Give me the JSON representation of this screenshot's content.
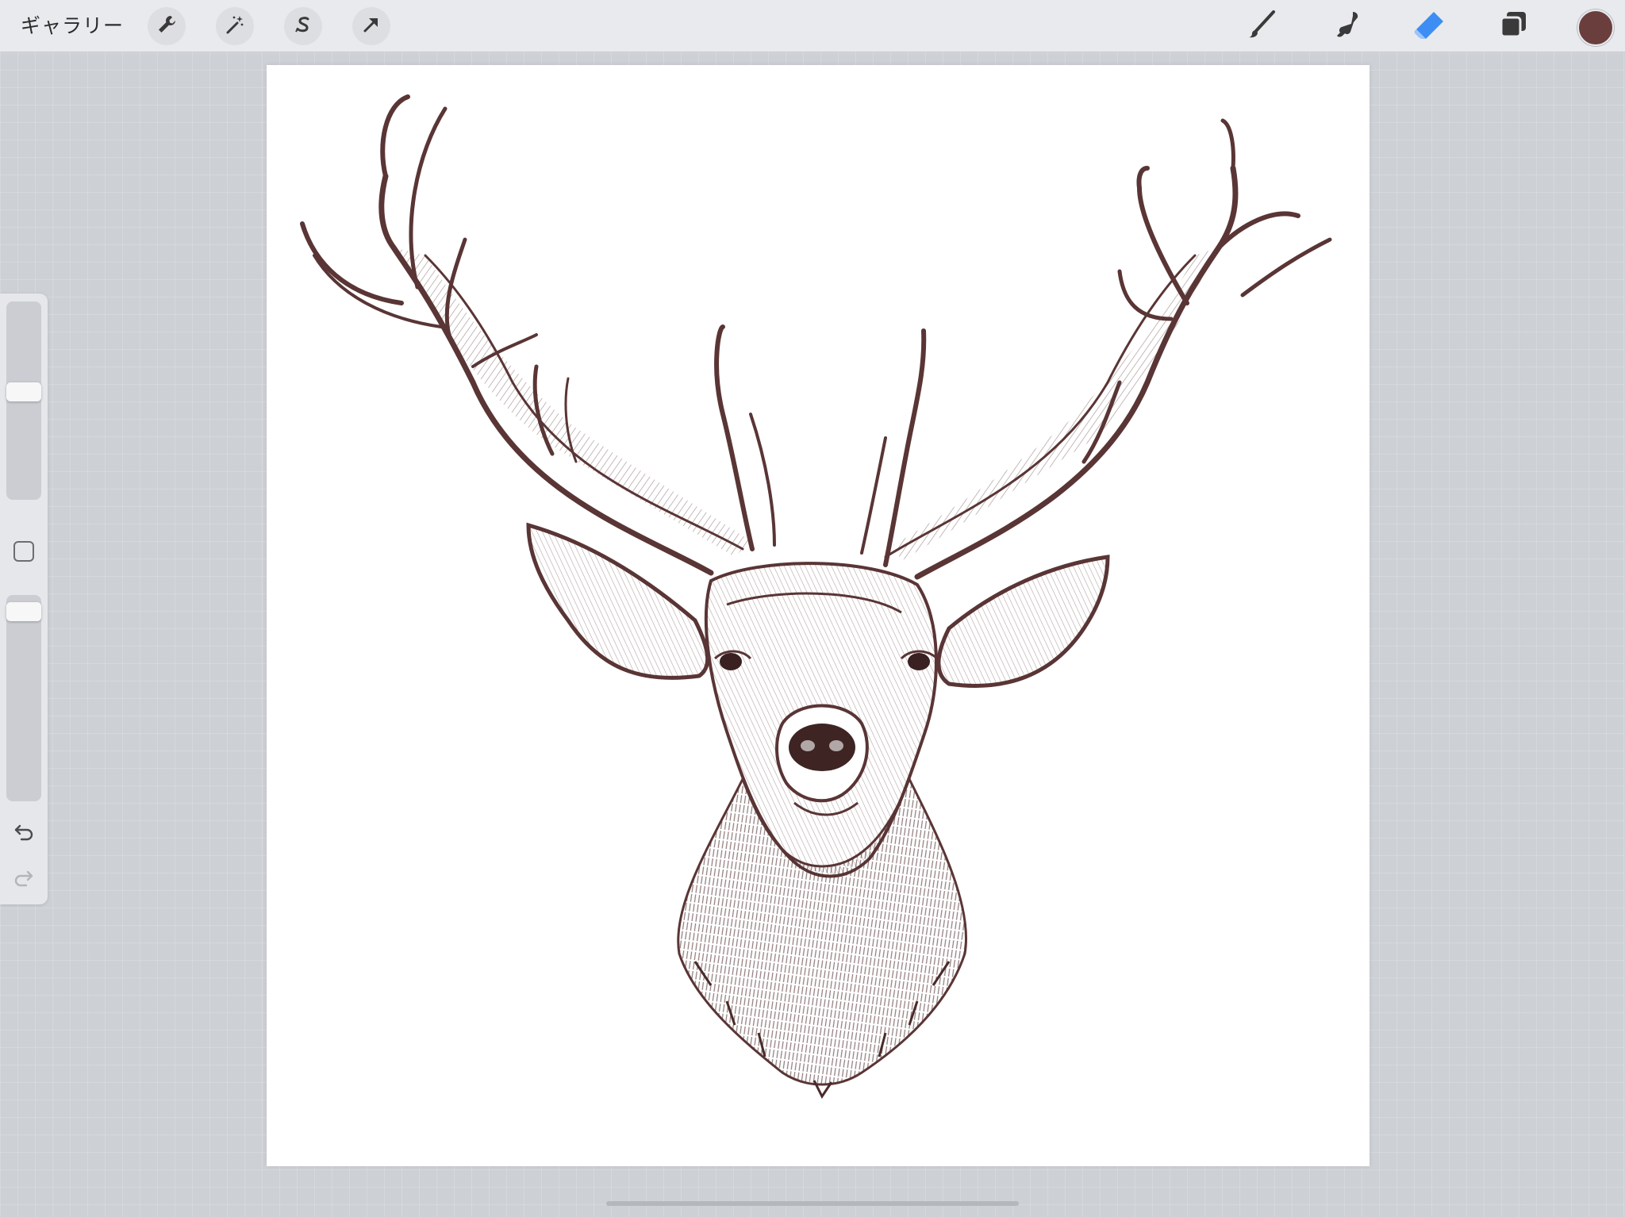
{
  "toolbar": {
    "gallery_label": "ギャラリー",
    "left_tools": [
      "wrench-icon",
      "magic-wand-icon",
      "selection-s-icon",
      "move-arrow-icon"
    ],
    "right_tools": [
      "brush-icon",
      "smudge-icon",
      "eraser-icon",
      "layers-icon"
    ],
    "active_tool": "eraser",
    "active_tool_color": "#3d8df5",
    "current_color": "#6b3e3e"
  },
  "canvas": {
    "background": "#ffffff",
    "content": "deer-head-illustration",
    "ink_color": "#5a3535"
  },
  "sidebar": {
    "brush_size_level": 0.55,
    "opacity_level": 0.96,
    "icons": [
      "modify-square-icon",
      "undo-icon",
      "redo-icon"
    ],
    "redo_enabled": false
  }
}
